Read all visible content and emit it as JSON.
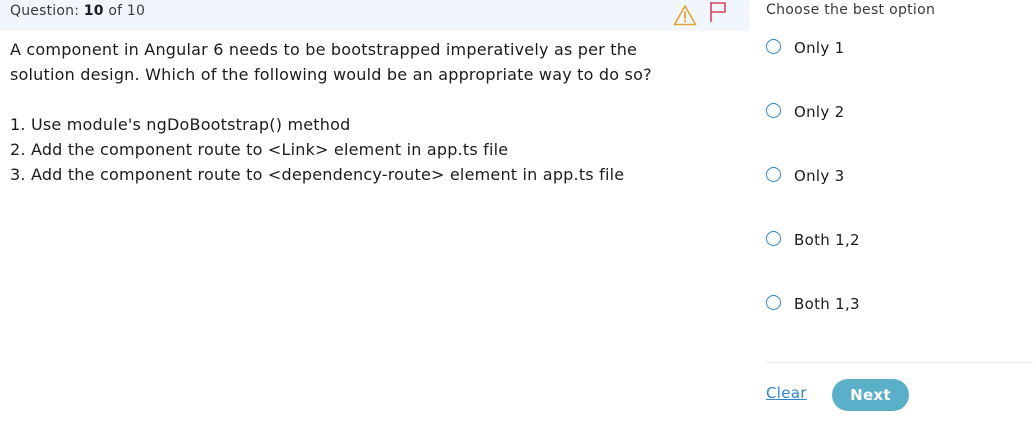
{
  "header": {
    "question_label": "Question:",
    "question_number": "10",
    "question_of": "of 10",
    "warning_icon": "warning-triangle-icon",
    "flag_icon": "flag-icon"
  },
  "question": {
    "line1": "A component in Angular 6 needs to be bootstrapped imperatively as per the",
    "line2": "solution design. Which of the following would be an appropriate way to do so?",
    "items": [
      "1. Use module's ngDoBootstrap() method",
      "2. Add the component route to <Link> element in app.ts file",
      "3. Add the component route to <dependency-route> element in app.ts file"
    ]
  },
  "answers": {
    "title": "Choose the best option",
    "options": [
      "Only 1",
      "Only 2",
      "Only 3",
      "Both 1,2",
      "Both 1,3"
    ],
    "clear_label": "Clear",
    "next_label": "Next"
  },
  "colors": {
    "header_bg": "#f1f6fd",
    "radio_border": "#2e86c9",
    "link": "#2e86c9",
    "next_button": "#5ab0c8",
    "warning": "#e8a13a",
    "flag": "#d6455e"
  }
}
